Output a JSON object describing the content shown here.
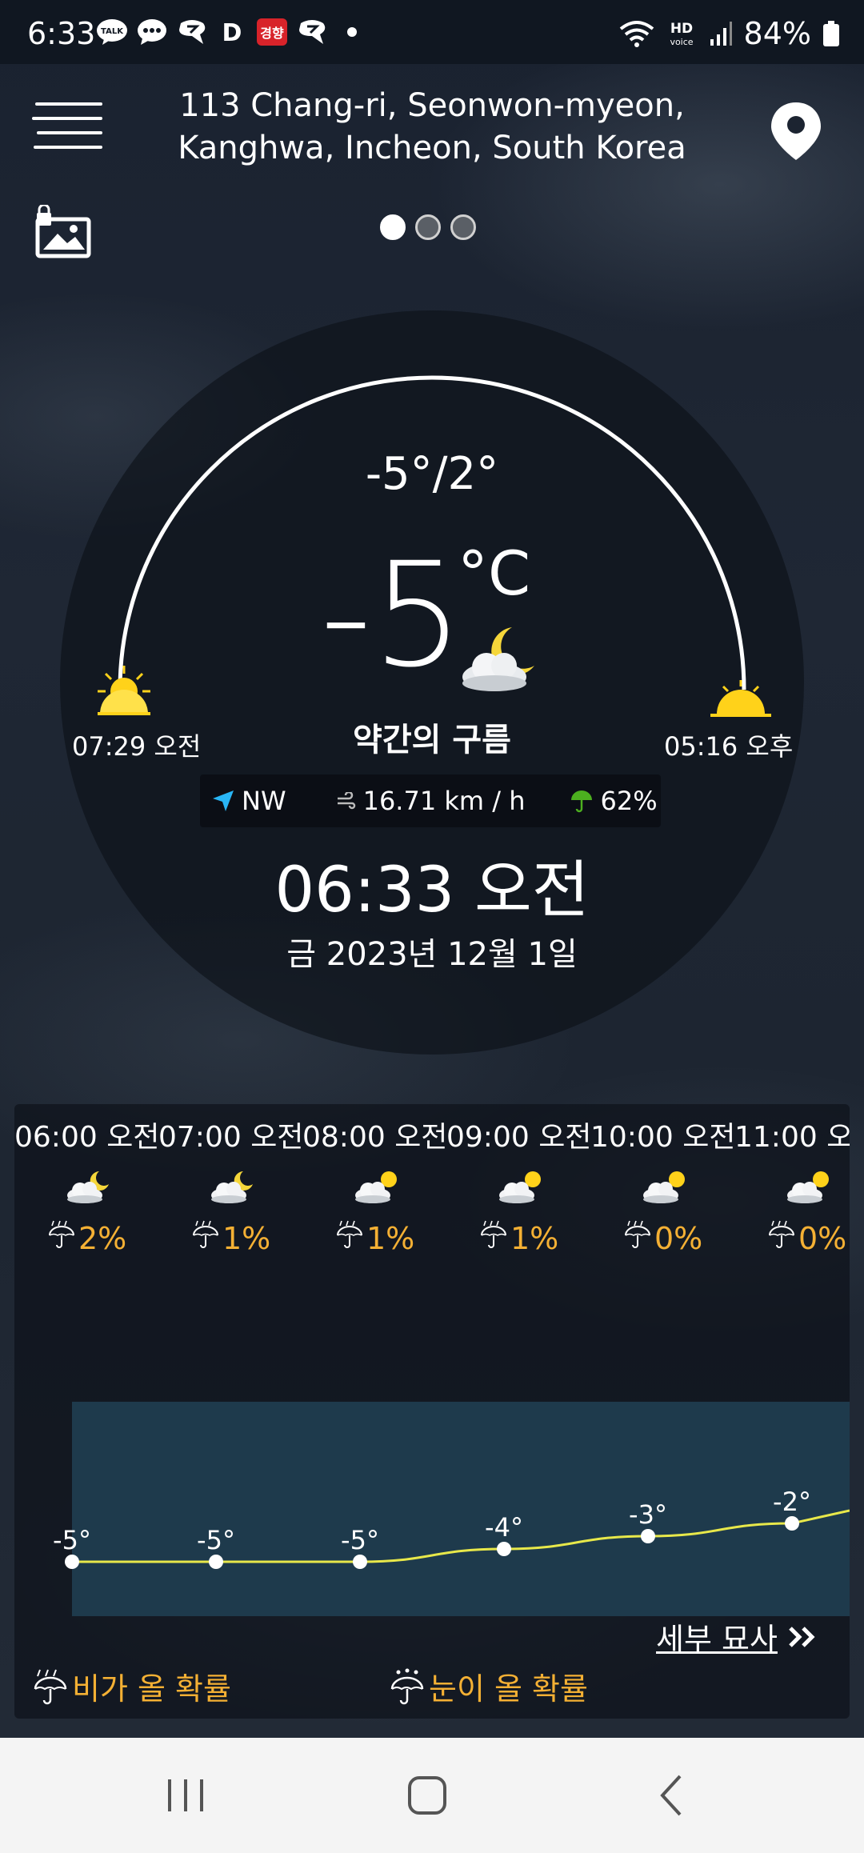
{
  "status_bar": {
    "time": "6:33",
    "notification_icons": [
      "kakaotalk-icon",
      "message-icon",
      "chat-icon",
      "d-app-icon",
      "news-app-icon",
      "chat-icon",
      "more-dot-icon"
    ],
    "network_label": "HD voice",
    "battery": "84%"
  },
  "header": {
    "address_line1": "113 Chang-ri, Seonwon-myeon,",
    "address_line2": "Kanghwa, Incheon, South Korea",
    "page_indicator": {
      "count": 3,
      "active": 0
    }
  },
  "current": {
    "hi_lo": "-5°/2°",
    "temp": "-5",
    "unit": "°C",
    "condition": "약간의 구름",
    "sunrise": "07:29 오전",
    "sunset": "05:16 오후",
    "wind_dir": "NW",
    "wind_speed": "16.71 km / h",
    "humidity": "62%",
    "time": "06:33 오전",
    "date": "금 2023년 12월 1일"
  },
  "hourly": [
    {
      "time": "06:00 오전",
      "icon": "night-partly-cloudy-icon",
      "precip": "2%",
      "temp": "-5°",
      "temp_value": -5
    },
    {
      "time": "07:00 오전",
      "icon": "night-partly-cloudy-icon",
      "precip": "1%",
      "temp": "-5°",
      "temp_value": -5
    },
    {
      "time": "08:00 오전",
      "icon": "partly-cloudy-icon",
      "precip": "1%",
      "temp": "-5°",
      "temp_value": -5
    },
    {
      "time": "09:00 오전",
      "icon": "partly-cloudy-icon",
      "precip": "1%",
      "temp": "-4°",
      "temp_value": -4
    },
    {
      "time": "10:00 오전",
      "icon": "partly-cloudy-icon",
      "precip": "0%",
      "temp": "-3°",
      "temp_value": -3
    },
    {
      "time": "11:00 오",
      "icon": "partly-cloudy-icon",
      "precip": "0%",
      "temp": "-2°",
      "temp_value": -2
    }
  ],
  "footer": {
    "detail_link": "세부 묘사",
    "legend_rain": "비가 올 확률",
    "legend_snow": "눈이 올 확률"
  },
  "colors": {
    "accent_orange": "#f4b034",
    "temp_line": "#e8e84a",
    "chart_fill": "#1e3a4c",
    "sun_yellow": "#ffd21a"
  }
}
